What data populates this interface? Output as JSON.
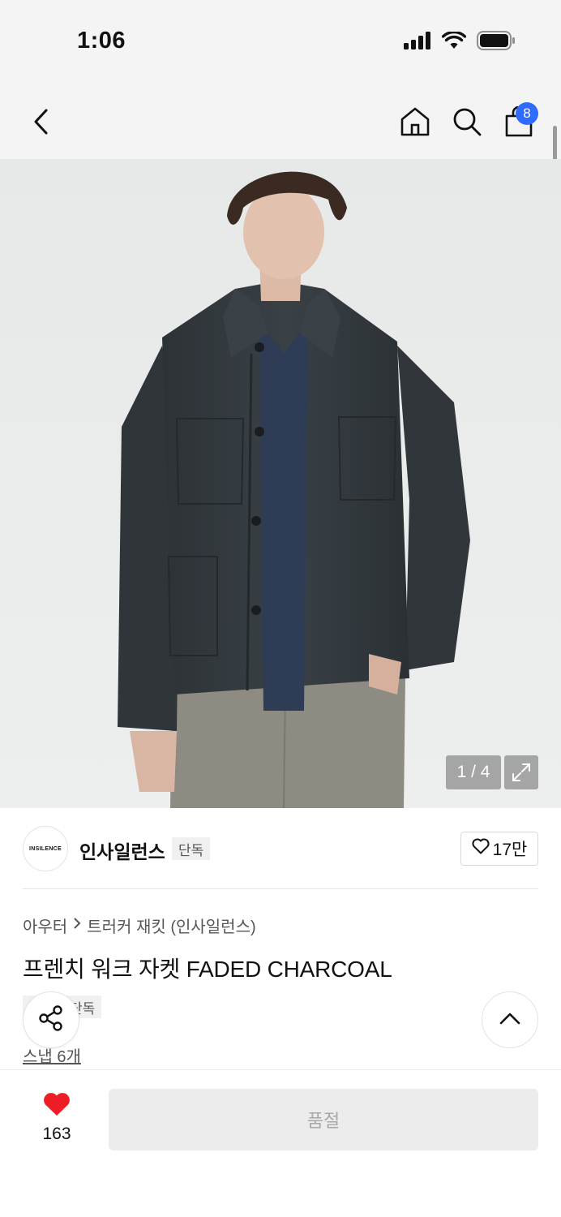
{
  "status_bar": {
    "time": "1:06",
    "icons": [
      "signal-icon",
      "wifi-icon",
      "battery-icon"
    ]
  },
  "nav": {
    "icons": [
      "back-icon",
      "home-icon",
      "search-icon",
      "cart-icon"
    ],
    "cart_badge": "8"
  },
  "hero": {
    "image_desc_icon": "product-photo",
    "counter": "1 / 4",
    "expand_icon": "expand-icon"
  },
  "brand": {
    "logo_text": "INSILENCE",
    "name": "인사일런스",
    "tag": "단독",
    "likes": "17만"
  },
  "product": {
    "breadcrumb": [
      "아우터",
      "트러커 재킷 (인사일런스)"
    ],
    "title": "프렌치 워크 자켓 FADED CHARCOAL",
    "tag": "단독",
    "snap_link": "스냅 6개"
  },
  "bottom_bar": {
    "wish_count": "163",
    "button_label": "품절"
  },
  "colors": {
    "accent_blue": "#2f6bff",
    "heart_red": "#ee1c25",
    "disabled_bg": "#ececec"
  }
}
